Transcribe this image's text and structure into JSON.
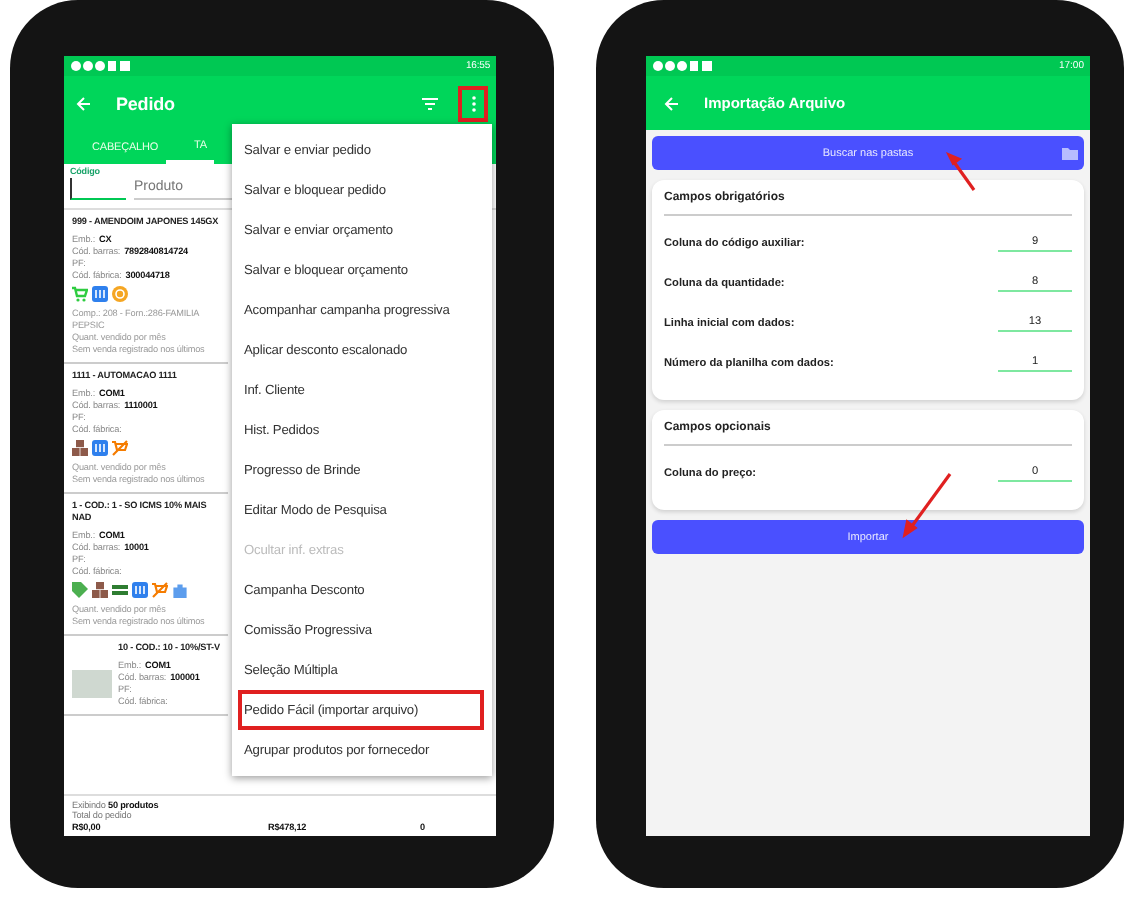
{
  "order_screen": {
    "status_bar": {
      "time": "16:55"
    },
    "app_bar": {
      "title": "Pedido",
      "more_highlighted": true
    },
    "tabs": [
      {
        "label": "CABEÇALHO",
        "selected": false
      },
      {
        "label": "TA",
        "selected": true
      }
    ],
    "search": {
      "code_label": "Código",
      "product_placeholder": "Produto"
    },
    "products": [
      {
        "title": "999 - AMENDOIM JAPONES 145GX",
        "has_photo": false,
        "fields": [
          {
            "label": "Emb.:",
            "value": "CX"
          },
          {
            "label": "Cód. barras:",
            "value": "7892840814724"
          },
          {
            "label": "PF:"
          },
          {
            "label": "Cód. fábrica:",
            "value": "300044718"
          }
        ],
        "badges": [
          {
            "kind": "cart"
          },
          {
            "kind": "book"
          },
          {
            "kind": "coin"
          }
        ],
        "notes": [
          "Comp.: 208 - Forn.:286-FAMILIA PEPSIC",
          "Quant. vendido por mês",
          "Sem venda registrado nos últimos"
        ]
      },
      {
        "title": "1111 - AUTOMACAO 1111",
        "has_photo": false,
        "fields": [
          {
            "label": "Emb.:",
            "value": "COM1"
          },
          {
            "label": "Cód. barras:",
            "value": "1110001"
          },
          {
            "label": "PF:"
          },
          {
            "label": "Cód. fábrica:"
          }
        ],
        "badges": [
          {
            "kind": "boxes"
          },
          {
            "kind": "book"
          },
          {
            "kind": "nocart"
          }
        ],
        "notes": [
          "Quant. vendido por mês",
          "Sem venda registrado nos últimos"
        ]
      },
      {
        "title": "1 - COD.: 1 - SO ICMS 10% MAIS NAD",
        "has_photo": false,
        "fields": [
          {
            "label": "Emb.:",
            "value": "COM1"
          },
          {
            "label": "Cód. barras:",
            "value": "10001"
          },
          {
            "label": "PF:"
          },
          {
            "label": "Cód. fábrica:"
          }
        ],
        "badges": [
          {
            "kind": "tag"
          },
          {
            "kind": "boxes"
          },
          {
            "kind": "stripes"
          },
          {
            "kind": "book"
          },
          {
            "kind": "nocart"
          },
          {
            "kind": "bag"
          }
        ],
        "notes": [
          "Quant. vendido por mês",
          "Sem venda registrado nos últimos"
        ]
      },
      {
        "title": "10 - COD.: 10 - 10%/ST-V",
        "has_photo": true,
        "fields": [
          {
            "label": "Emb.:",
            "value": "COM1"
          },
          {
            "label": "Cód. barras:",
            "value": "100001"
          },
          {
            "label": "PF:"
          },
          {
            "label": "Cód. fábrica:"
          }
        ]
      }
    ],
    "footer": {
      "showing": "Exibindo **50 produtos**",
      "total_label": "Total do pedido",
      "total_value": "R$0,00",
      "column_2": "R$478,12",
      "column_3": "0"
    },
    "menu": [
      {
        "label": "Salvar e enviar pedido",
        "disabled": false,
        "highlighted": false
      },
      {
        "label": "Salvar e bloquear pedido",
        "disabled": false,
        "highlighted": false
      },
      {
        "label": "Salvar e enviar orçamento",
        "disabled": false,
        "highlighted": false
      },
      {
        "label": "Salvar e bloquear orçamento",
        "disabled": false,
        "highlighted": false
      },
      {
        "label": "Acompanhar campanha progressiva",
        "disabled": false,
        "highlighted": false
      },
      {
        "label": "Aplicar desconto escalonado",
        "disabled": false,
        "highlighted": false
      },
      {
        "label": "Inf. Cliente",
        "disabled": false,
        "highlighted": false
      },
      {
        "label": "Hist. Pedidos",
        "disabled": false,
        "highlighted": false
      },
      {
        "label": "Progresso de Brinde",
        "disabled": false,
        "highlighted": false
      },
      {
        "label": "Editar Modo de Pesquisa",
        "disabled": false,
        "highlighted": false
      },
      {
        "label": "Ocultar inf. extras",
        "disabled": true,
        "highlighted": false
      },
      {
        "label": "Campanha Desconto",
        "disabled": false,
        "highlighted": false
      },
      {
        "label": "Comissão Progressiva",
        "disabled": false,
        "highlighted": false
      },
      {
        "label": "Seleção Múltipla",
        "disabled": false,
        "highlighted": false
      },
      {
        "label": "Pedido Fácil (importar arquivo)",
        "disabled": false,
        "highlighted": true
      },
      {
        "label": "Agrupar produtos por fornecedor",
        "disabled": false,
        "highlighted": false
      }
    ]
  },
  "import_screen": {
    "status_bar": {
      "time": "17:00"
    },
    "app_bar": {
      "title": "Importação Arquivo"
    },
    "browse_button": "Buscar nas pastas",
    "sections": [
      {
        "title": "Campos obrigatórios",
        "fields": [
          {
            "label": "Coluna do código auxiliar:",
            "value": "9"
          },
          {
            "label": "Coluna da quantidade:",
            "value": "8"
          },
          {
            "label": "Linha inicial com dados:",
            "value": "13"
          },
          {
            "label": "Número da planilha com dados:",
            "value": "1"
          }
        ]
      },
      {
        "title": "Campos opcionais",
        "fields": [
          {
            "label": "Coluna do preço:",
            "value": "0"
          }
        ]
      }
    ],
    "import_button": "Importar"
  }
}
